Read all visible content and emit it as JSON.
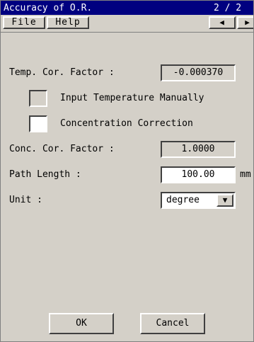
{
  "window": {
    "title": "Accuracy of O.R.",
    "page_indicator": "2 / 2"
  },
  "menubar": {
    "file_label": "File",
    "help_label": "Help",
    "prev_icon": "◀",
    "next_icon": "▶"
  },
  "form": {
    "temp_cor_factor": {
      "label": "Temp. Cor. Factor :",
      "value": "-0.000370"
    },
    "input_temp_manually": {
      "label": "Input Temperature Manually",
      "checked": false
    },
    "concentration_correction": {
      "label": "Concentration Correction",
      "checked": false
    },
    "conc_cor_factor": {
      "label": "Conc. Cor. Factor :",
      "value": "1.0000"
    },
    "path_length": {
      "label": "Path Length :",
      "value": "100.00",
      "unit": "mm"
    },
    "unit": {
      "label": "Unit :",
      "selected": "degree",
      "dropdown_icon": "▼"
    }
  },
  "buttons": {
    "ok_label": "OK",
    "cancel_label": "Cancel"
  },
  "colors": {
    "titlebar_bg": "#000080",
    "titlebar_text": "#ffffff",
    "panel_bg": "#d4d0c8"
  }
}
